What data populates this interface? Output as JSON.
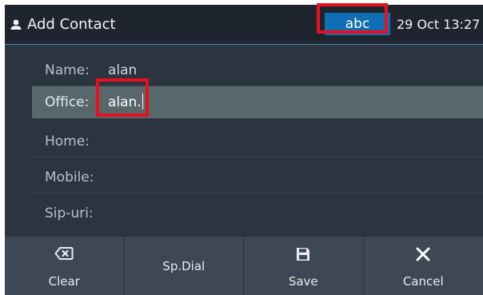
{
  "header": {
    "title": "Add Contact",
    "ime_mode": "abc",
    "datetime": "29 Oct 13:27"
  },
  "form": {
    "fields": [
      {
        "label": "Name:",
        "value": "alan"
      },
      {
        "label": "Office:",
        "value": "alan."
      },
      {
        "label": "Home:",
        "value": ""
      },
      {
        "label": "Mobile:",
        "value": ""
      },
      {
        "label": "Sip-uri:",
        "value": ""
      }
    ],
    "selected_index": 1
  },
  "softkeys": [
    {
      "label": "Clear",
      "icon": "backspace-icon"
    },
    {
      "label": "Sp.Dial",
      "icon": ""
    },
    {
      "label": "Save",
      "icon": "save-icon"
    },
    {
      "label": "Cancel",
      "icon": "close-icon"
    }
  ],
  "colors": {
    "highlight": "#e8101c",
    "ime_badge": "#0f6fb2",
    "selected_row": "#58676a"
  }
}
